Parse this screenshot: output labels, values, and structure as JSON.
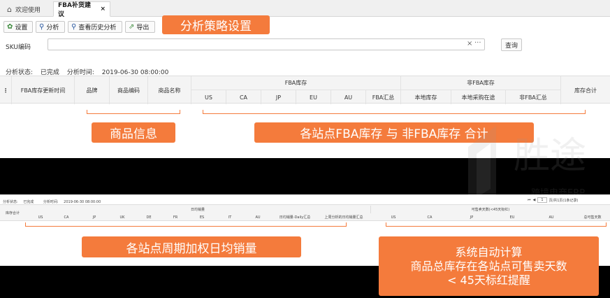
{
  "tabs": {
    "home": "欢迎使用",
    "active": "FBA补货建议"
  },
  "toolbar": {
    "settings": "设置",
    "analyze": "分析",
    "history": "查看历史分析",
    "export": "导出"
  },
  "search": {
    "label": "SKU编码",
    "value": "",
    "clear": "×",
    "more": "···",
    "query_button": "查询"
  },
  "status": {
    "state_label": "分析状态:",
    "state_value": "已完成",
    "time_label": "分析时间:",
    "time_value": "2019-06-30 08:00:00"
  },
  "table_header": {
    "menu_glyph": "⋮",
    "columns": [
      "FBA库存更新时间",
      "品牌",
      "商品编码",
      "商品名称"
    ],
    "fba_group": "FBA库存",
    "fba_sites": [
      "US",
      "CA",
      "JP",
      "EU",
      "AU",
      "FBA汇总"
    ],
    "non_fba_group": "非FBA库存",
    "non_fba_cols": [
      "本地库存",
      "本地采购在途",
      "非FBA汇总"
    ],
    "total": "库存合计"
  },
  "callouts": {
    "strategy": "分析策略设置",
    "product_info": "商品信息",
    "stock_sites": "各站点FBA库存 与 非FBA库存 合计",
    "daily_sales": "各站点周期加权日均销量",
    "auto_calc_1": "系统自动计算",
    "auto_calc_2": "商品总库存在各站点可售卖天数",
    "auto_calc_3": "< 45天标红提醒"
  },
  "bottom": {
    "status_label": "分析状态:",
    "status_value": "已完成",
    "time_label": "分析时间:",
    "time_value": "2019-06-30 08:00:00",
    "pager_page": "1",
    "pager_text": "页/共1页(1条记录)",
    "stock_total": "库存合计",
    "daily_group": "日均销量",
    "daily_sites": [
      "US",
      "CA",
      "JP",
      "UK",
      "DE",
      "FR",
      "ES",
      "IT",
      "AU",
      "日均销量-Daily汇总",
      "上周分析的日均销量汇总"
    ],
    "days_group": "可售卖天数(<45天标红)",
    "days_sites": [
      "US",
      "CA",
      "JP",
      "EU",
      "AU",
      "总可售天数"
    ]
  },
  "watermark": {
    "brand": "胜途",
    "sub": "跨境电商ERP"
  },
  "colors": {
    "accent": "#f47b3c",
    "link_blue": "#2c5aa0",
    "green": "#3c8a3c"
  }
}
